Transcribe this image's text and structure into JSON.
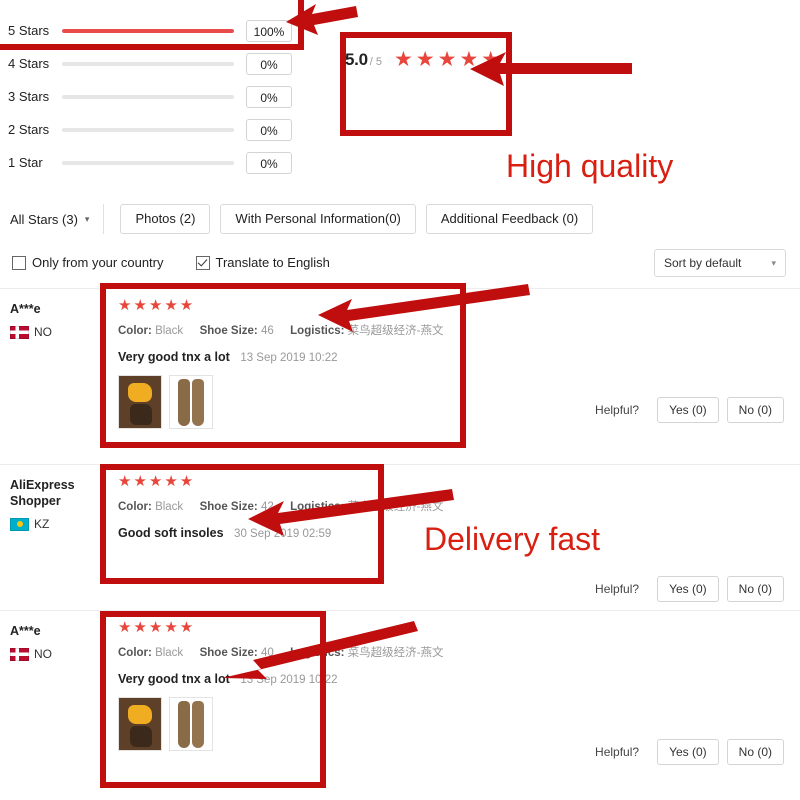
{
  "rating_distribution": {
    "rows": [
      {
        "label": "5 Stars",
        "percent": "100%",
        "value": 100
      },
      {
        "label": "4 Stars",
        "percent": "0%",
        "value": 0
      },
      {
        "label": "3 Stars",
        "percent": "0%",
        "value": 0
      },
      {
        "label": "2 Stars",
        "percent": "0%",
        "value": 0
      },
      {
        "label": "1 Star",
        "percent": "0%",
        "value": 0
      }
    ],
    "fill_color": "#e94b4b",
    "track_color": "#e6e6e6"
  },
  "score": {
    "value": "5.0",
    "denominator": "/ 5",
    "stars": "★★★★★",
    "star_color": "#e8463c"
  },
  "annotations": {
    "high_quality": "High quality",
    "delivery_fast": "Delivery fast",
    "color": "#d81f12"
  },
  "filters": {
    "all_stars": "All Stars (3)",
    "caret": "chevron-down-icon",
    "chips": [
      "Photos (2)",
      "With Personal Information(0)",
      "Additional Feedback (0)"
    ]
  },
  "options": {
    "only_country": {
      "label": "Only from your country",
      "checked": false
    },
    "translate": {
      "label": "Translate to English",
      "checked": true
    },
    "sort": {
      "label": "Sort by default"
    }
  },
  "reviews": [
    {
      "user": "A***e",
      "country_code": "NO",
      "flag": "norway-flag-icon",
      "stars": "★★★★★",
      "color_label": "Color:",
      "color_value": "Black",
      "size_label": "Shoe Size:",
      "size_value": "46",
      "logistics_label": "Logistics:",
      "logistics_value": "菜鸟超级经济-燕文",
      "text": "Very good tnx a lot",
      "date": "13 Sep 2019 10:22",
      "has_photos": true,
      "helpful_label": "Helpful?",
      "yes": "Yes (0)",
      "no": "No (0)"
    },
    {
      "user": "AliExpress Shopper",
      "country_code": "KZ",
      "flag": "kazakhstan-flag-icon",
      "stars": "★★★★★",
      "color_label": "Color:",
      "color_value": "Black",
      "size_label": "Shoe Size:",
      "size_value": "42",
      "logistics_label": "Logistics:",
      "logistics_value": "菜鸟超级经济-燕文",
      "text": "Good soft insoles",
      "date": "30 Sep 2019 02:59",
      "has_photos": false,
      "helpful_label": "Helpful?",
      "yes": "Yes (0)",
      "no": "No (0)"
    },
    {
      "user": "A***e",
      "country_code": "NO",
      "flag": "norway-flag-icon",
      "stars": "★★★★★",
      "color_label": "Color:",
      "color_value": "Black",
      "size_label": "Shoe Size:",
      "size_value": "40",
      "logistics_label": "Logistics:",
      "logistics_value": "菜鸟超级经济-燕文",
      "text": "Very good tnx a lot",
      "date": "13 Sep 2019 10:22",
      "has_photos": true,
      "helpful_label": "Helpful?",
      "yes": "Yes (0)",
      "no": "No (0)"
    }
  ]
}
